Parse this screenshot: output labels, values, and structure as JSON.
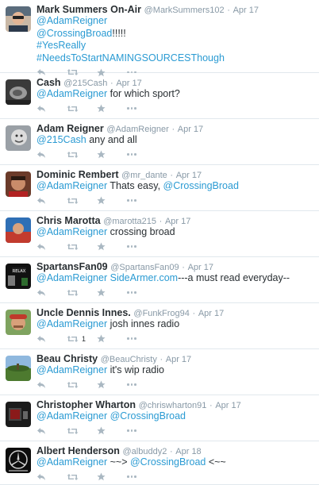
{
  "tweets": [
    {
      "name": "Mark Summers On-Air",
      "handle": "@MarkSummers102",
      "time": "Apr 17",
      "lines": [
        [
          {
            "t": "@AdamReigner",
            "k": "mention"
          }
        ],
        [
          {
            "t": "@CrossingBroad",
            "k": "mention"
          },
          {
            "t": "!!!!!",
            "k": "plain"
          }
        ],
        [
          {
            "t": "#YesReally",
            "k": "hashtag"
          }
        ],
        [
          {
            "t": "#NeedsToStartNAMINGSOURCESThough",
            "k": "hashtag"
          }
        ]
      ],
      "retweet_count": "",
      "avatar": "avatar-mark-summers"
    },
    {
      "name": "Cash",
      "handle": "@215Cash",
      "time": "Apr 17",
      "lines": [
        [
          {
            "t": "@AdamReigner",
            "k": "mention"
          },
          {
            "t": " for which sport?",
            "k": "plain"
          }
        ]
      ],
      "retweet_count": "",
      "avatar": "avatar-cash"
    },
    {
      "name": "Adam Reigner",
      "handle": "@AdamReigner",
      "time": "Apr 17",
      "lines": [
        [
          {
            "t": "@215Cash",
            "k": "mention"
          },
          {
            "t": " any and all",
            "k": "plain"
          }
        ]
      ],
      "retweet_count": "",
      "avatar": "avatar-adam-reigner"
    },
    {
      "name": "Dominic Rembert",
      "handle": "@mr_dante",
      "time": "Apr 17",
      "lines": [
        [
          {
            "t": "@AdamReigner",
            "k": "mention"
          },
          {
            "t": " Thats easy, ",
            "k": "plain"
          },
          {
            "t": "@CrossingBroad",
            "k": "mention"
          }
        ]
      ],
      "retweet_count": "",
      "avatar": "avatar-dominic-rembert"
    },
    {
      "name": "Chris Marotta",
      "handle": "@marotta215",
      "time": "Apr 17",
      "lines": [
        [
          {
            "t": "@AdamReigner",
            "k": "mention"
          },
          {
            "t": " crossing broad",
            "k": "plain"
          }
        ]
      ],
      "retweet_count": "",
      "avatar": "avatar-chris-marotta"
    },
    {
      "name": "SpartansFan09",
      "handle": "@SpartansFan09",
      "time": "Apr 17",
      "lines": [
        [
          {
            "t": "@AdamReigner",
            "k": "mention"
          },
          {
            "t": " ",
            "k": "plain"
          },
          {
            "t": "SideArmer.com",
            "k": "link"
          },
          {
            "t": "---a must read everyday--",
            "k": "plain"
          }
        ]
      ],
      "retweet_count": "",
      "avatar": "avatar-spartansfan09"
    },
    {
      "name": "Uncle Dennis Innes.",
      "handle": "@FunkFrog94",
      "time": "Apr 17",
      "lines": [
        [
          {
            "t": "@AdamReigner",
            "k": "mention"
          },
          {
            "t": " josh innes radio",
            "k": "plain"
          }
        ]
      ],
      "retweet_count": "1",
      "avatar": "avatar-uncle-dennis"
    },
    {
      "name": "Beau Christy",
      "handle": "@BeauChristy",
      "time": "Apr 17",
      "lines": [
        [
          {
            "t": "@AdamReigner",
            "k": "mention"
          },
          {
            "t": " it's wip radio",
            "k": "plain"
          }
        ]
      ],
      "retweet_count": "",
      "avatar": "avatar-beau-christy"
    },
    {
      "name": "Christopher Wharton",
      "handle": "@chriswharton91",
      "time": "Apr 17",
      "lines": [
        [
          {
            "t": "@AdamReigner",
            "k": "mention"
          },
          {
            "t": " ",
            "k": "plain"
          },
          {
            "t": "@CrossingBroad",
            "k": "mention"
          }
        ]
      ],
      "retweet_count": "",
      "avatar": "avatar-christopher-wharton"
    },
    {
      "name": "Albert Henderson",
      "handle": "@albuddy2",
      "time": "Apr 18",
      "lines": [
        [
          {
            "t": "@AdamReigner",
            "k": "mention"
          },
          {
            "t": " ~~> ",
            "k": "plain"
          },
          {
            "t": "@CrossingBroad",
            "k": "mention"
          },
          {
            "t": " <~~",
            "k": "plain"
          }
        ]
      ],
      "retweet_count": "",
      "avatar": "avatar-albert-henderson"
    }
  ],
  "separator": "·",
  "colors": {
    "link": "#2b9bd3",
    "muted": "#8899a6",
    "icon": "#aab8c2",
    "text": "#292f33",
    "divider": "#e1e8ed"
  }
}
